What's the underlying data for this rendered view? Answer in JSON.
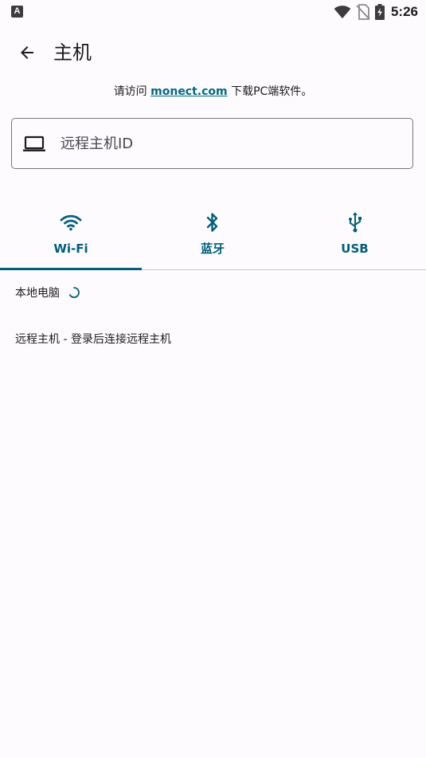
{
  "status_bar": {
    "app_icon_letter": "A",
    "time": "5:26"
  },
  "app_bar": {
    "title": "主机"
  },
  "hint": {
    "prefix": "请访问 ",
    "link": "monect.com",
    "suffix": " 下载PC端软件。"
  },
  "host_id_field": {
    "placeholder": "远程主机ID",
    "icon": "laptop-icon"
  },
  "tabs": [
    {
      "label": "Wi-Fi",
      "icon": "wifi-icon",
      "selected": true
    },
    {
      "label": "蓝牙",
      "icon": "bluetooth-icon",
      "selected": false
    },
    {
      "label": "USB",
      "icon": "usb-icon",
      "selected": false
    }
  ],
  "list": {
    "local_pc": "本地电脑",
    "remote_host": "远程主机 - 登录后连接远程主机"
  },
  "colors": {
    "accent": "#00607a",
    "link": "#006a84",
    "background": "#fefbff",
    "outline": "#79747e"
  }
}
